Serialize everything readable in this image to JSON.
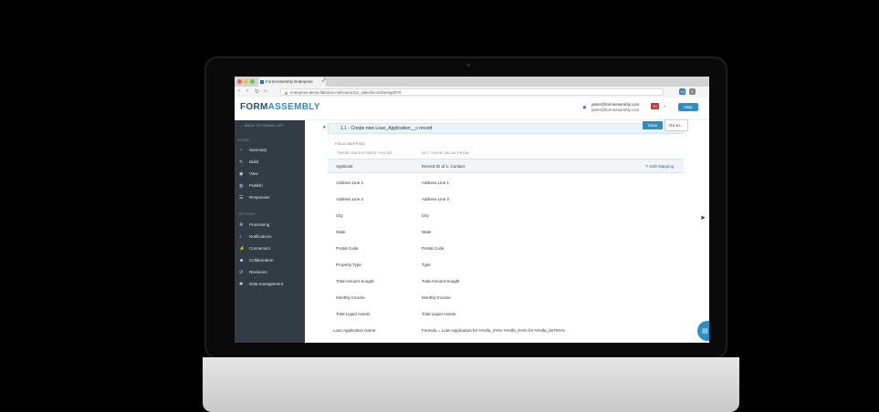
{
  "browser": {
    "tab_title": "FormAssembly Enterprise",
    "url": "enterprise-demo.tfaforms.net/connector_salesforce/2/setup/978",
    "new_tab": "+",
    "tab_close": "×",
    "ext_badge": "12"
  },
  "app": {
    "logo_part1": "FORM",
    "logo_part2": "ASSEMBLY",
    "user_email_1": "peter@formassembly.com",
    "user_email_2": "peter@formassembly.com",
    "notif_count": "20",
    "help_label": "Help"
  },
  "sidebar": {
    "back_label": "← BACK TO FORMS LIST",
    "form_header": "FORM",
    "form_items": [
      {
        "label": "Summary",
        "icon": "dashboard-icon"
      },
      {
        "label": "Build",
        "icon": "wrench-icon"
      },
      {
        "label": "View",
        "icon": "eye-icon"
      },
      {
        "label": "Publish",
        "icon": "globe-icon"
      },
      {
        "label": "Responses",
        "icon": "list-icon"
      }
    ],
    "options_header": "OPTIONS",
    "option_items": [
      {
        "label": "Processing",
        "icon": "gears-icon"
      },
      {
        "label": "Notifications",
        "icon": "bell-icon"
      },
      {
        "label": "Connectors",
        "icon": "plug-icon"
      },
      {
        "label": "Collaboration",
        "icon": "users-icon"
      },
      {
        "label": "Revisions",
        "icon": "history-icon"
      },
      {
        "label": "Data management",
        "icon": "gear-icon"
      }
    ]
  },
  "main": {
    "section_title": "1.1 - Create new Loan_Application__c record",
    "save_label": "Save",
    "goto_label": "Go to...",
    "field_mapping_title": "FIELD MAPPING",
    "col1_header": "THESE SALESFORCE FIELDS",
    "col2_header": "GET THEIR VALUE FROM",
    "edit_mapping_label": "✎ Edit Mapping",
    "rows": [
      {
        "sf": "Applicant",
        "from": "Record ID of 1. Contact"
      },
      {
        "sf": "Address Line 1",
        "from": "Address Line 1"
      },
      {
        "sf": "Address Line 2",
        "from": "Address Line 2"
      },
      {
        "sf": "City",
        "from": "City"
      },
      {
        "sf": "State",
        "from": "State"
      },
      {
        "sf": "Postal Code",
        "from": "Postal Code"
      },
      {
        "sf": "Property Type",
        "from": "Type"
      },
      {
        "sf": "Total Amount Sought",
        "from": "Total Amount Sought"
      },
      {
        "sf": "Monthly Income",
        "from": "Monthly Income"
      },
      {
        "sf": "Total Liquid Assets",
        "from": "Total Liquid Assets"
      },
      {
        "sf": "Loan Application Name",
        "from": "Formula = Loan Application for %%tfa_2%% %%tfa_4%% for %%tfa_2678%%"
      }
    ]
  },
  "colors": {
    "sidebar_bg": "#323c44",
    "accent": "#2a8fc9",
    "logo_dark": "#244e7a",
    "badge_red": "#d9302c"
  }
}
